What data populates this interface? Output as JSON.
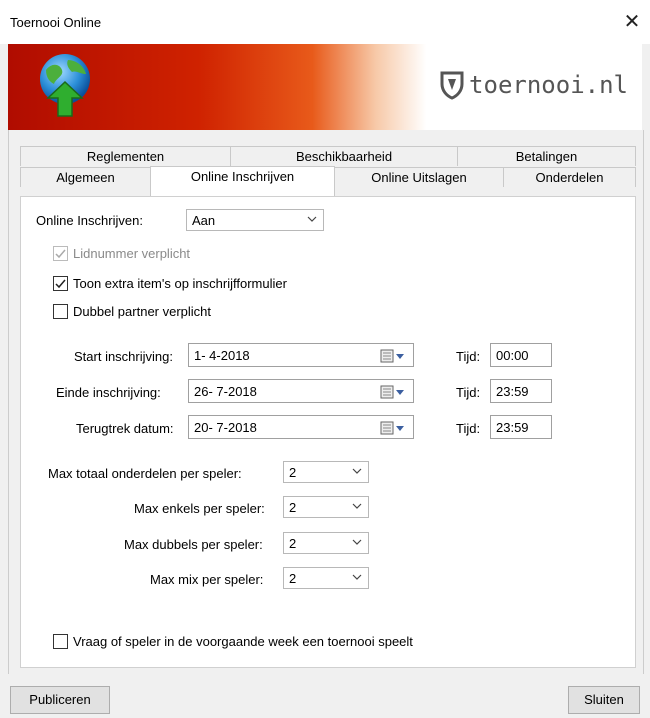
{
  "window": {
    "title": "Toernooi Online",
    "close_glyph": "✕"
  },
  "banner": {
    "brand_text": "toernooi.nl",
    "logo_icon": "globe-upload-icon",
    "brand_icon": "shield-icon"
  },
  "tabs": {
    "row_top": [
      "Reglementen",
      "Beschikbaarheid",
      "Betalingen"
    ],
    "row_bottom": [
      "Algemeen",
      "Online Inschrijven",
      "Online Uitslagen",
      "Onderdelen"
    ],
    "active": "Online Inschrijven"
  },
  "form": {
    "online_inschrijven": {
      "label": "Online Inschrijven:",
      "value": "Aan"
    },
    "lidnummer": {
      "label": "Lidnummer verplicht",
      "checked": true,
      "disabled": true
    },
    "extra_items": {
      "label": "Toon extra item's op inschrijfformulier",
      "checked": true
    },
    "dubbel_partner": {
      "label": "Dubbel partner verplicht",
      "checked": false
    },
    "start": {
      "label": "Start inschrijving:",
      "date": "1- 4-2018",
      "tijd_label": "Tijd:",
      "tijd": "00:00"
    },
    "einde": {
      "label": "Einde inschrijving:",
      "date": "26- 7-2018",
      "tijd_label": "Tijd:",
      "tijd": "23:59"
    },
    "terugtrek": {
      "label": "Terugtrek datum:",
      "date": "20- 7-2018",
      "tijd_label": "Tijd:",
      "tijd": "23:59"
    },
    "max_totaal": {
      "label": "Max totaal onderdelen per speler:",
      "value": "2"
    },
    "max_enkels": {
      "label": "Max enkels per speler:",
      "value": "2"
    },
    "max_dubbels": {
      "label": "Max dubbels per speler:",
      "value": "2"
    },
    "max_mix": {
      "label": "Max mix per speler:",
      "value": "2"
    },
    "vraag": {
      "label": "Vraag of speler in de voorgaande week een toernooi speelt",
      "checked": false
    }
  },
  "buttons": {
    "publiceren": "Publiceren",
    "sluiten": "Sluiten"
  }
}
